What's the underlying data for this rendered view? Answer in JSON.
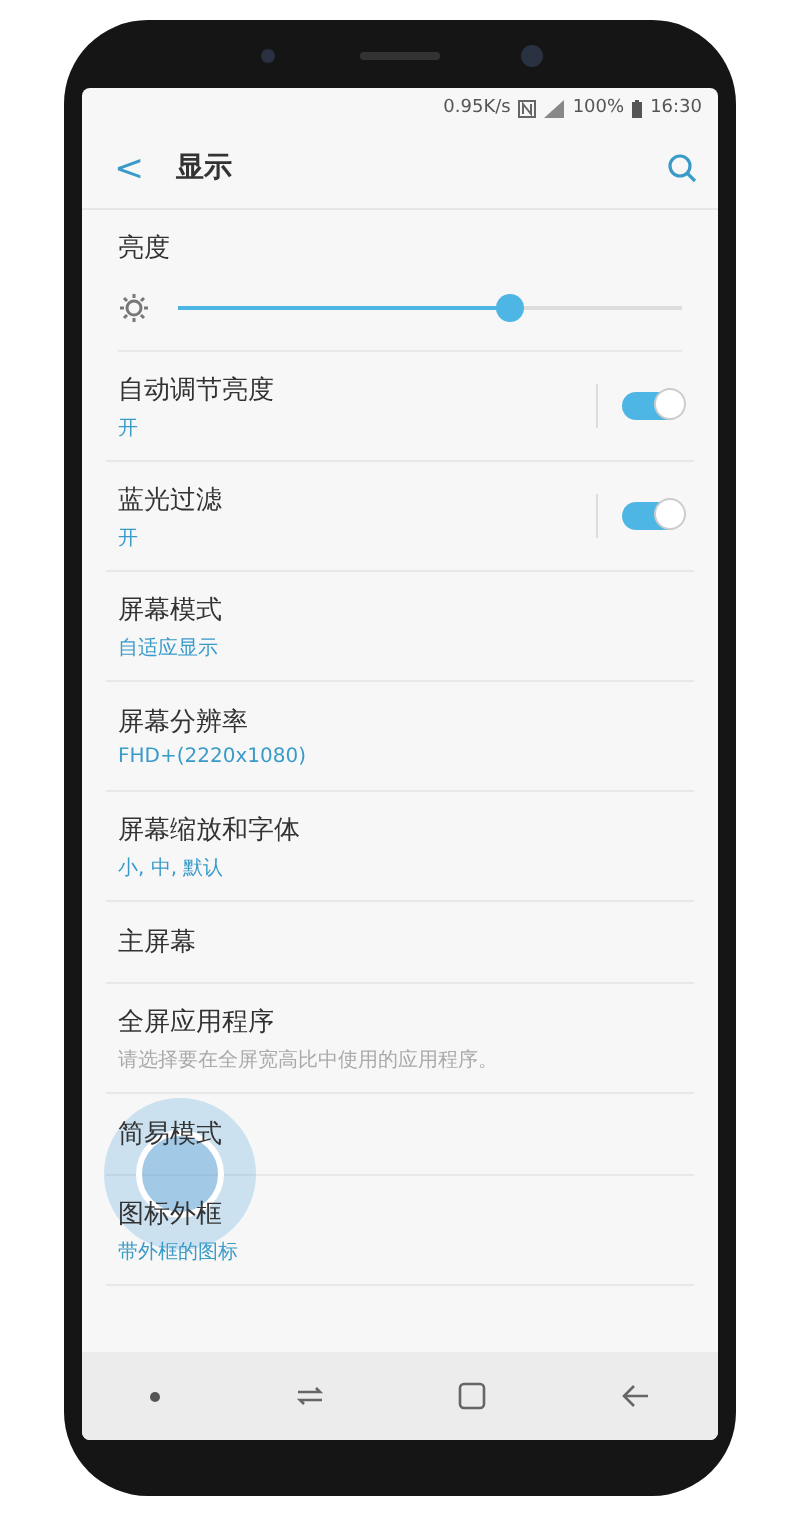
{
  "status_bar": {
    "speed": "0.95K/s",
    "battery": "100%",
    "time": "16:30"
  },
  "header": {
    "back": "<",
    "title": "显示"
  },
  "brightness": {
    "label": "亮度",
    "level": 0.66
  },
  "items": [
    {
      "kind": "toggle",
      "title": "自动调节亮度",
      "subtitle": "开",
      "on": true
    },
    {
      "kind": "toggle",
      "title": "蓝光过滤",
      "subtitle": "开",
      "on": true
    },
    {
      "kind": "link",
      "title": "屏幕模式",
      "subtitle": "自适应显示"
    },
    {
      "kind": "link",
      "title": "屏幕分辨率",
      "subtitle": "FHD+(2220x1080)"
    },
    {
      "kind": "link",
      "title": "屏幕缩放和字体",
      "subtitle": "小, 中, 默认"
    },
    {
      "kind": "link",
      "title": "主屏幕"
    },
    {
      "kind": "note",
      "title": "全屏应用程序",
      "subtitle": "请选择要在全屏宽高比中使用的应用程序。"
    },
    {
      "kind": "link",
      "title": "简易模式",
      "tapped": true
    },
    {
      "kind": "link",
      "title": "图标外框",
      "subtitle": "带外框的图标"
    }
  ]
}
